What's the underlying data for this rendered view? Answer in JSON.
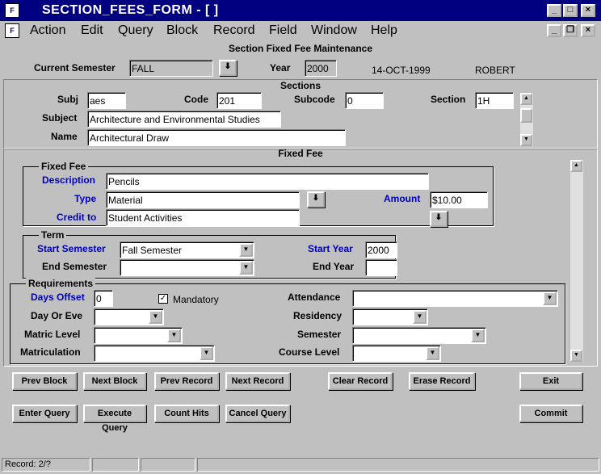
{
  "window": {
    "title": "SECTION_FEES_FORM - [ ]",
    "icon": "forms-app-icon"
  },
  "menu": [
    "Action",
    "Edit",
    "Query",
    "Block",
    "Record",
    "Field",
    "Window",
    "Help"
  ],
  "form_title": "Section Fixed Fee Maintenance",
  "header": {
    "current_semester_label": "Current Semester",
    "current_semester_value": "FALL",
    "year_label": "Year",
    "year_value": "2000",
    "date": "14-OCT-1999",
    "user": "ROBERT"
  },
  "sections": {
    "title": "Sections",
    "subj_label": "Subj",
    "subj_value": "aes",
    "code_label": "Code",
    "code_value": "201",
    "subcode_label": "Subcode",
    "subcode_value": "0",
    "section_label": "Section",
    "section_value": "1H",
    "subject_label": "Subject",
    "subject_value": "Architecture and Environmental Studies",
    "name_label": "Name",
    "name_value": "Architectural Draw"
  },
  "fixed_fee_title": "Fixed Fee",
  "fixed_fee": {
    "group_title": "Fixed Fee",
    "description_label": "Description",
    "description_value": "Pencils",
    "type_label": "Type",
    "type_value": "Material",
    "amount_label": "Amount",
    "amount_value": "$10.00",
    "credit_to_label": "Credit to",
    "credit_to_value": "Student Activities"
  },
  "term": {
    "group_title": "Term",
    "start_semester_label": "Start Semester",
    "start_semester_value": "Fall Semester",
    "start_year_label": "Start Year",
    "start_year_value": "2000",
    "end_semester_label": "End Semester",
    "end_semester_value": "",
    "end_year_label": "End Year",
    "end_year_value": ""
  },
  "requirements": {
    "group_title": "Requirements",
    "days_offset_label": "Days Offset",
    "days_offset_value": "0",
    "mandatory_label": "Mandatory",
    "mandatory_checked": true,
    "check_mark": "✓",
    "attendance_label": "Attendance",
    "attendance_value": "",
    "day_or_eve_label": "Day Or Eve",
    "day_or_eve_value": "",
    "residency_label": "Residency",
    "residency_value": "",
    "matric_level_label": "Matric Level",
    "matric_level_value": "",
    "semester_label": "Semester",
    "semester_value": "",
    "matriculation_label": "Matriculation",
    "matriculation_value": "",
    "course_level_label": "Course Level",
    "course_level_value": ""
  },
  "buttons": {
    "prev_block": "Prev Block",
    "next_block": "Next Block",
    "prev_record": "Prev Record",
    "next_record": "Next Record",
    "clear_record": "Clear Record",
    "erase_record": "Erase Record",
    "exit": "Exit",
    "enter_query": "Enter Query",
    "execute_query": "Execute Query",
    "count_hits": "Count Hits",
    "cancel_query": "Cancel Query",
    "commit": "Commit"
  },
  "status": {
    "record": "Record: 2/?"
  },
  "colors": {
    "titlebar": "#000080",
    "label_blue": "#0000c0",
    "background": "#c0c0c0"
  }
}
